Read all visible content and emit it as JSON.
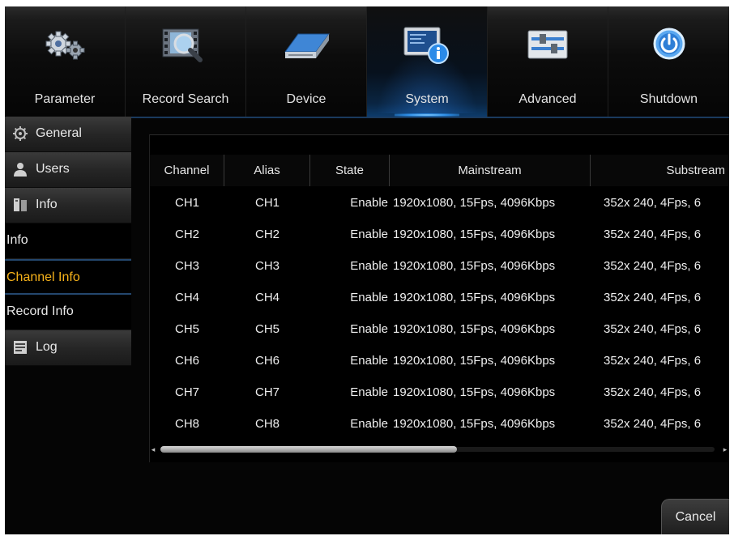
{
  "nav": {
    "items": [
      {
        "label": "Parameter",
        "icon": "gears-icon"
      },
      {
        "label": "Record Search",
        "icon": "film-search-icon"
      },
      {
        "label": "Device",
        "icon": "hard-drive-icon"
      },
      {
        "label": "System",
        "icon": "system-info-icon",
        "active": true
      },
      {
        "label": "Advanced",
        "icon": "sliders-icon"
      },
      {
        "label": "Shutdown",
        "icon": "power-icon"
      }
    ]
  },
  "sidebar": {
    "items": [
      {
        "label": "General",
        "type": "category",
        "icon": "gear-icon"
      },
      {
        "label": "Users",
        "type": "category",
        "icon": "user-icon"
      },
      {
        "label": "Info",
        "type": "category",
        "icon": "info-book-icon"
      },
      {
        "label": "Info",
        "type": "sub"
      },
      {
        "label": "Channel Info",
        "type": "sub",
        "selected": true
      },
      {
        "label": "Record Info",
        "type": "sub"
      },
      {
        "label": "Log",
        "type": "category",
        "icon": "log-icon"
      }
    ]
  },
  "table": {
    "headers": [
      "Channel",
      "Alias",
      "State",
      "Mainstream",
      "Substream"
    ],
    "rows": [
      [
        "CH1",
        "CH1",
        "Enable",
        "1920x1080, 15Fps, 4096Kbps",
        "352x 240, 4Fps, 6"
      ],
      [
        "CH2",
        "CH2",
        "Enable",
        "1920x1080, 15Fps, 4096Kbps",
        "352x 240, 4Fps, 6"
      ],
      [
        "CH3",
        "CH3",
        "Enable",
        "1920x1080, 15Fps, 4096Kbps",
        "352x 240, 4Fps, 6"
      ],
      [
        "CH4",
        "CH4",
        "Enable",
        "1920x1080, 15Fps, 4096Kbps",
        "352x 240, 4Fps, 6"
      ],
      [
        "CH5",
        "CH5",
        "Enable",
        "1920x1080, 15Fps, 4096Kbps",
        "352x 240, 4Fps, 6"
      ],
      [
        "CH6",
        "CH6",
        "Enable",
        "1920x1080, 15Fps, 4096Kbps",
        "352x 240, 4Fps, 6"
      ],
      [
        "CH7",
        "CH7",
        "Enable",
        "1920x1080, 15Fps, 4096Kbps",
        "352x 240, 4Fps, 6"
      ],
      [
        "CH8",
        "CH8",
        "Enable",
        "1920x1080, 15Fps, 4096Kbps",
        "352x 240, 4Fps, 6"
      ]
    ]
  },
  "footer": {
    "cancel_label": "Cancel"
  },
  "colors": {
    "background": "#000000",
    "accent": "#2d8ee8",
    "selected_text": "#f6b21a",
    "text": "#e8e8e8"
  }
}
